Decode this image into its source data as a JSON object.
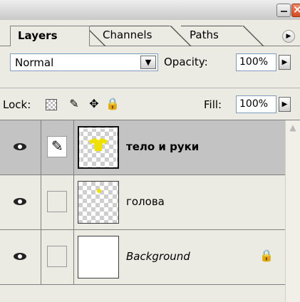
{
  "tabs": [
    "Layers",
    "Channels",
    "Paths"
  ],
  "blend_mode": "Normal",
  "opacity": {
    "label": "Opacity:",
    "value": "100%"
  },
  "lock": {
    "label": "Lock:"
  },
  "fill": {
    "label": "Fill:",
    "value": "100%"
  },
  "layers": [
    {
      "name": "тело и руки",
      "selected": true,
      "visible": true
    },
    {
      "name": "голова",
      "selected": false,
      "visible": true
    },
    {
      "name": "Background",
      "selected": false,
      "visible": true,
      "locked": true
    }
  ],
  "colors": {
    "panel_bg": "#ecebe3",
    "selected_row": "#c3c3c3",
    "thumb_shape": "#f0e000",
    "close_button": "#d44a22"
  },
  "icons": [
    "minimize-icon",
    "close-icon",
    "panel-menu-arrow-icon",
    "dropdown-arrow-icon",
    "transparency-lock-icon",
    "brush-lock-icon",
    "move-lock-icon",
    "padlock-icon",
    "eye-icon",
    "brush-icon",
    "scroll-up-icon"
  ]
}
